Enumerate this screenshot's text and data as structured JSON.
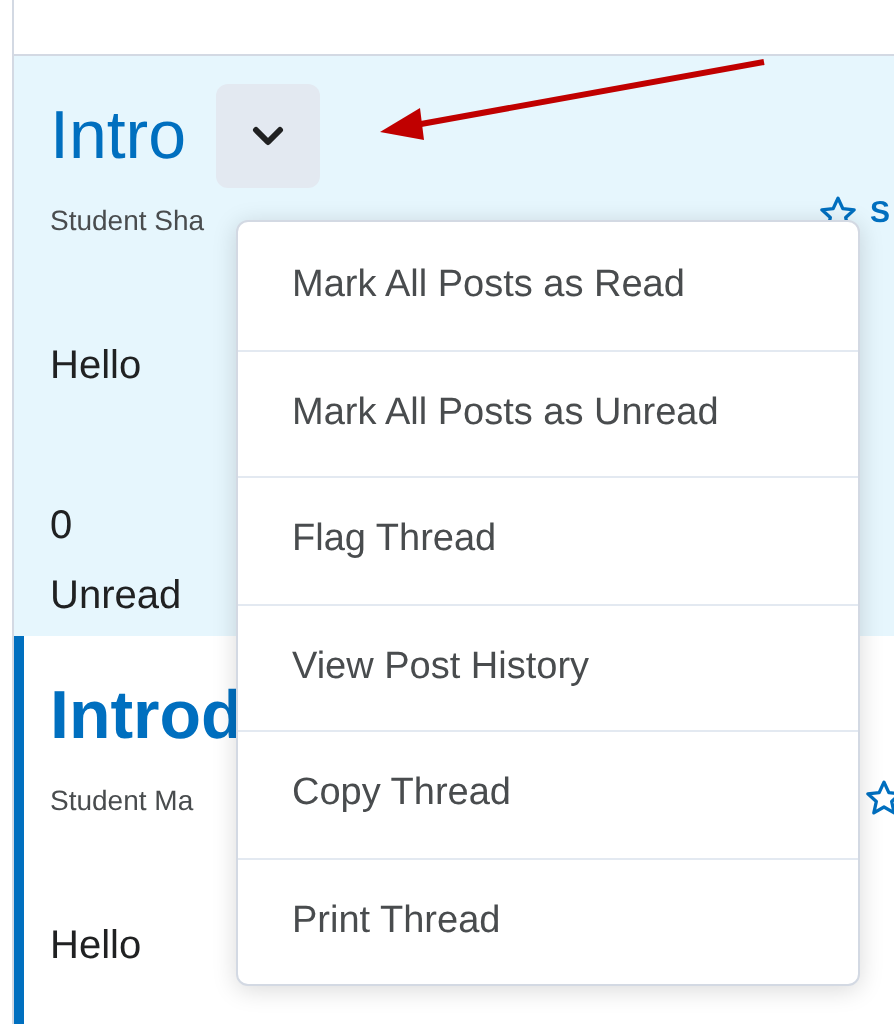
{
  "posts": [
    {
      "title": "Intro",
      "author_line": "Student Sha",
      "subscribe_label": "S",
      "body": "Hello",
      "unread_count": "0",
      "unread_label": "Unread",
      "highlighted": true
    },
    {
      "title": "Introd",
      "author_line": "Student Ma",
      "body": "Hello",
      "highlighted": false
    }
  ],
  "menu": {
    "items": [
      {
        "label": "Mark All Posts as Read"
      },
      {
        "label": "Mark All Posts as Unread"
      },
      {
        "label": "Flag Thread"
      },
      {
        "label": "View Post History"
      },
      {
        "label": "Copy Thread"
      },
      {
        "label": "Print Thread"
      }
    ]
  }
}
